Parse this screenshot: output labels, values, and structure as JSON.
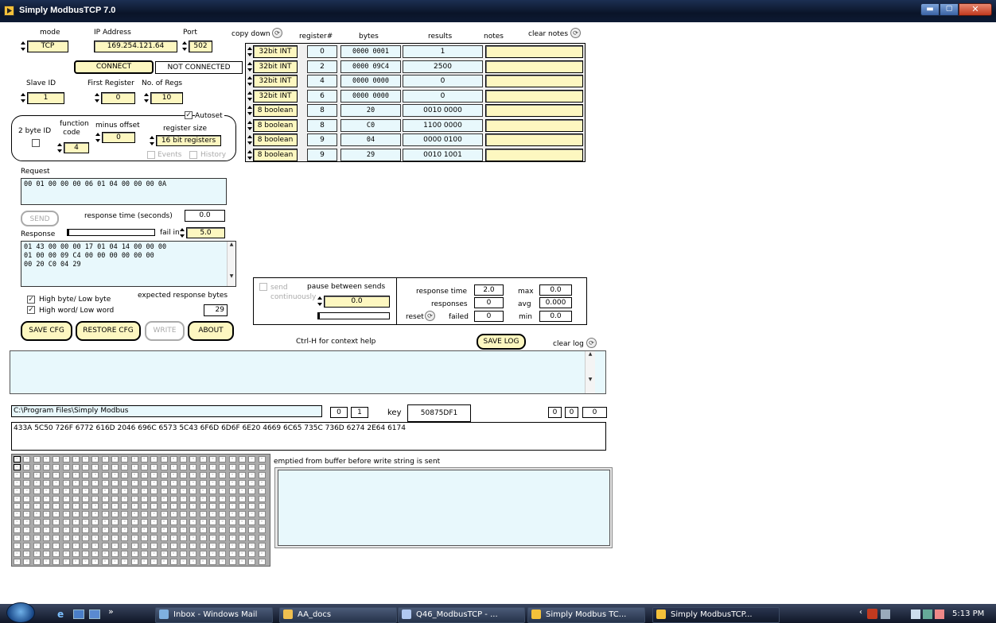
{
  "window": {
    "title": "Simply ModbusTCP 7.0"
  },
  "conn": {
    "mode_label": "mode",
    "ip_label": "IP Address",
    "port_label": "Port",
    "mode": "TCP",
    "ip": "169.254.121.64",
    "port": "502",
    "connect": "CONNECT",
    "status": "NOT CONNECTED"
  },
  "regs": {
    "slave_label": "Slave ID",
    "first_label": "First Register",
    "num_label": "No. of Regs",
    "slave": "1",
    "first": "0",
    "num": "10"
  },
  "options": {
    "two_byte": "2 byte ID",
    "func_label": "function code",
    "func": "4",
    "offset_label": "minus offset",
    "offset": "0",
    "autoset": "Autoset",
    "size_label": "register size",
    "size": "16 bit registers",
    "events": "Events",
    "history": "History"
  },
  "table": {
    "copy_down": "copy down",
    "h_reg": "register#",
    "h_bytes": "bytes",
    "h_results": "results",
    "h_notes": "notes",
    "clear_notes": "clear notes",
    "rows": [
      {
        "type": "32bit INT",
        "reg": "0",
        "bytes": "0000 0001",
        "result": "1"
      },
      {
        "type": "32bit INT",
        "reg": "2",
        "bytes": "0000 09C4",
        "result": "2500"
      },
      {
        "type": "32bit INT",
        "reg": "4",
        "bytes": "0000 0000",
        "result": "0"
      },
      {
        "type": "32bit INT",
        "reg": "6",
        "bytes": "0000 0000",
        "result": "0"
      },
      {
        "type": "8 boolean",
        "reg": "8",
        "bytes": "20",
        "result": "0010 0000"
      },
      {
        "type": "8 boolean",
        "reg": "8",
        "bytes": "C0",
        "result": "1100 0000"
      },
      {
        "type": "8 boolean",
        "reg": "9",
        "bytes": "04",
        "result": "0000 0100"
      },
      {
        "type": "8 boolean",
        "reg": "9",
        "bytes": "29",
        "result": "0010 1001"
      }
    ]
  },
  "request": {
    "label": "Request",
    "value": "00 01 00 00 00 06 01 04 00 00 00 0A"
  },
  "send": {
    "label": "SEND",
    "rt_label": "response time (seconds)",
    "rt": "0.0",
    "fail_label": "fail in",
    "fail": "5.0"
  },
  "response": {
    "label": "Response",
    "text": "01 43 00 00 00 17 01 04 14 00 00 00\n01 00 00 09 C4 00 00 00 00 00 00\n00 20 C0 04 29"
  },
  "order": {
    "hb": "High byte/ Low byte",
    "hw": "High word/ Low word",
    "exp_label": "expected response bytes",
    "exp": "29"
  },
  "buttons": {
    "save_cfg": "SAVE CFG",
    "restore_cfg": "RESTORE CFG",
    "write": "WRITE",
    "about": "ABOUT",
    "save_log": "SAVE LOG"
  },
  "loop": {
    "send_cont": "send continuously",
    "pause_label": "pause between sends",
    "pause": "0.0",
    "rt_label": "response time",
    "rt": "2.0",
    "resp_label": "responses",
    "resp": "0",
    "failed_label": "failed",
    "failed": "0",
    "reset_label": "reset",
    "max_label": "max",
    "max": "0.0",
    "avg_label": "avg",
    "avg": "0.000",
    "min_label": "min",
    "min": "0.0"
  },
  "log": {
    "help": "Ctrl-H for context help",
    "clear": "clear log"
  },
  "path": {
    "value": "C:\\Program Files\\Simply Modbus",
    "n1": "0",
    "n2": "1",
    "key_label": "key",
    "key": "50875DF1",
    "z1": "0",
    "z2": "0",
    "z3": "0",
    "hex": "433A 5C50 726F 6772 616D 2046 696C 6573 5C43 6F6D 6D6F 6E20 4669 6C65 735C 736D 6274 2E64 6174"
  },
  "buffer": {
    "note": "emptied from buffer before write string is sent"
  },
  "taskbar": {
    "t1": "Inbox - Windows Mail",
    "t2": "AA_docs",
    "t3": "Q46_ModbusTCP - ...",
    "t4": "Simply Modbus TC...",
    "t5": "Simply ModbusTCP...",
    "clock": "5:13 PM"
  }
}
